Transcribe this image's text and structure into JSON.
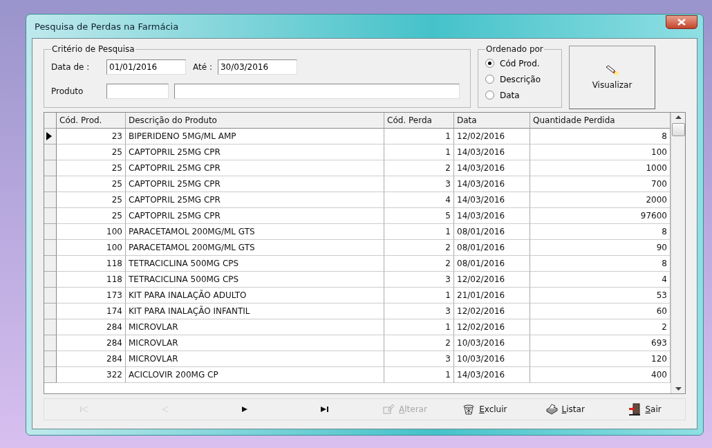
{
  "window": {
    "title": "Pesquisa de Perdas na Farmácia"
  },
  "criteria": {
    "title": "Critério de Pesquisa",
    "date_from_label": "Data de :",
    "date_from": "01/01/2016",
    "date_to_label": "Até :",
    "date_to": "30/03/2016",
    "product_label": "Produto"
  },
  "order": {
    "title": "Ordenado por",
    "options": [
      {
        "label": "Cód Prod.",
        "selected": true
      },
      {
        "label": "Descrição",
        "selected": false
      },
      {
        "label": "Data",
        "selected": false
      }
    ]
  },
  "view_button": "Visualizar",
  "table": {
    "columns": [
      "Cód. Prod.",
      "Descrição do Produto",
      "Cód. Perda",
      "Data",
      "Quantidade Perdida"
    ],
    "rows": [
      {
        "cells": [
          "23",
          "BIPERIDENO 5MG/ML AMP",
          "1",
          "12/02/2016",
          "8"
        ],
        "selected": true
      },
      {
        "cells": [
          "25",
          "CAPTOPRIL 25MG CPR",
          "1",
          "14/03/2016",
          "100"
        ],
        "selected": false
      },
      {
        "cells": [
          "25",
          "CAPTOPRIL 25MG CPR",
          "2",
          "14/03/2016",
          "1000"
        ],
        "selected": false
      },
      {
        "cells": [
          "25",
          "CAPTOPRIL 25MG CPR",
          "3",
          "14/03/2016",
          "700"
        ],
        "selected": false
      },
      {
        "cells": [
          "25",
          "CAPTOPRIL 25MG CPR",
          "4",
          "14/03/2016",
          "2000"
        ],
        "selected": false
      },
      {
        "cells": [
          "25",
          "CAPTOPRIL 25MG CPR",
          "5",
          "14/03/2016",
          "97600"
        ],
        "selected": false
      },
      {
        "cells": [
          "100",
          "PARACETAMOL 200MG/ML GTS",
          "1",
          "08/01/2016",
          "8"
        ],
        "selected": false
      },
      {
        "cells": [
          "100",
          "PARACETAMOL 200MG/ML GTS",
          "2",
          "08/01/2016",
          "90"
        ],
        "selected": false
      },
      {
        "cells": [
          "118",
          "TETRACICLINA 500MG CPS",
          "2",
          "08/01/2016",
          "8"
        ],
        "selected": false
      },
      {
        "cells": [
          "118",
          "TETRACICLINA 500MG CPS",
          "3",
          "12/02/2016",
          "4"
        ],
        "selected": false
      },
      {
        "cells": [
          "173",
          "KIT PARA INALAÇÃO ADULTO",
          "1",
          "21/01/2016",
          "53"
        ],
        "selected": false
      },
      {
        "cells": [
          "174",
          "KIT PARA INALAÇÃO INFANTIL",
          "3",
          "12/02/2016",
          "60"
        ],
        "selected": false
      },
      {
        "cells": [
          "284",
          "MICROVLAR",
          "1",
          "12/02/2016",
          "2"
        ],
        "selected": false
      },
      {
        "cells": [
          "284",
          "MICROVLAR",
          "2",
          "10/03/2016",
          "693"
        ],
        "selected": false
      },
      {
        "cells": [
          "284",
          "MICROVLAR",
          "3",
          "10/03/2016",
          "120"
        ],
        "selected": false
      },
      {
        "cells": [
          "322",
          "ACICLOVIR 200MG CP",
          "1",
          "14/03/2016",
          "400"
        ],
        "selected": false
      }
    ]
  },
  "navigator": [
    {
      "kind": "first",
      "disabled": true
    },
    {
      "kind": "prev",
      "disabled": true
    },
    {
      "kind": "next",
      "disabled": false
    },
    {
      "kind": "last",
      "disabled": false
    }
  ],
  "actions": [
    {
      "kind": "edit",
      "label": "Alterar",
      "disabled": true
    },
    {
      "kind": "delete",
      "label": "Excluir",
      "disabled": false
    },
    {
      "kind": "print",
      "label": "Listar",
      "disabled": false
    },
    {
      "kind": "exit",
      "label": "Sair",
      "disabled": false
    }
  ]
}
